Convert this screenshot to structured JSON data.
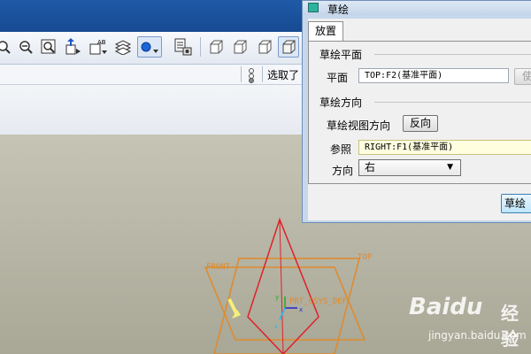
{
  "toolbar": {
    "icons": [
      "zoom-in-icon",
      "zoom-out-icon",
      "refit-icon",
      "reorient-icon",
      "saved-views-icon",
      "layers-icon",
      "display-style-icon",
      "view-manager-icon",
      "shaded-icon",
      "hidden-line-icon",
      "no-hidden-icon",
      "wireframe-icon",
      "shading-icon"
    ]
  },
  "status": {
    "text": "选取了"
  },
  "dialog": {
    "title": "草绘",
    "tab_label": "放置",
    "section_plane": "草绘平面",
    "plane_label": "平面",
    "plane_value": "TOP:F2(基准平面)",
    "use_button": "使",
    "section_orientation": "草绘方向",
    "view_direction_label": "草绘视图方向",
    "flip_button": "反向",
    "reference_label": "参照",
    "reference_value": "RIGHT:F1(基准平面)",
    "orientation_label": "方向",
    "orientation_value": "右",
    "sketch_button": "草绘"
  },
  "viewport": {
    "front_label": "FRONT",
    "top_label": "TOP",
    "csys_label": "PRT_CSYS_DEF",
    "x_label": "x",
    "y_label": "y",
    "z_label": "z",
    "colors": {
      "front_plane": "#e08a2a",
      "right_plane": "#e0202a",
      "csys_x": "#2222cc",
      "csys_y": "#22aa22",
      "csys_z": "#22bbee",
      "arrow": "#f5f07a"
    }
  },
  "watermark": {
    "brand": "Baidu",
    "brand_cn": "经验",
    "url": "jingyan.baidu.com"
  }
}
